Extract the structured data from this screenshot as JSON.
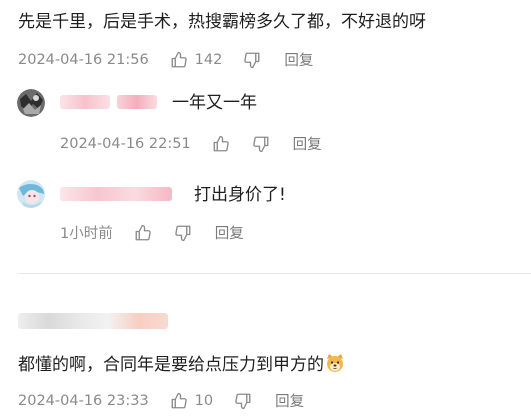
{
  "comments": [
    {
      "text": "先是千里，后是手术，热搜霸榜多久了都，不好退的呀",
      "time": "2024-04-16 21:56",
      "likes": "142",
      "reply_label": "回复"
    },
    {
      "text": "一年又一年",
      "time": "2024-04-16 22:51",
      "likes": "",
      "reply_label": "回复"
    },
    {
      "text": "打出身价了!",
      "time": "1小时前",
      "likes": "",
      "reply_label": "回复"
    },
    {
      "text": "都懂的啊，合同年是要给点压力到甲方的",
      "time": "2024-04-16 23:33",
      "likes": "10",
      "reply_label": "回复"
    }
  ],
  "icons": {
    "like": "thumbs-up-icon",
    "dislike": "thumbs-down-icon",
    "emoji": "dog-face-emoji"
  },
  "colors": {
    "meta_gray": "#8a8a8a",
    "username_blur_pink": "#f7c6cf"
  }
}
